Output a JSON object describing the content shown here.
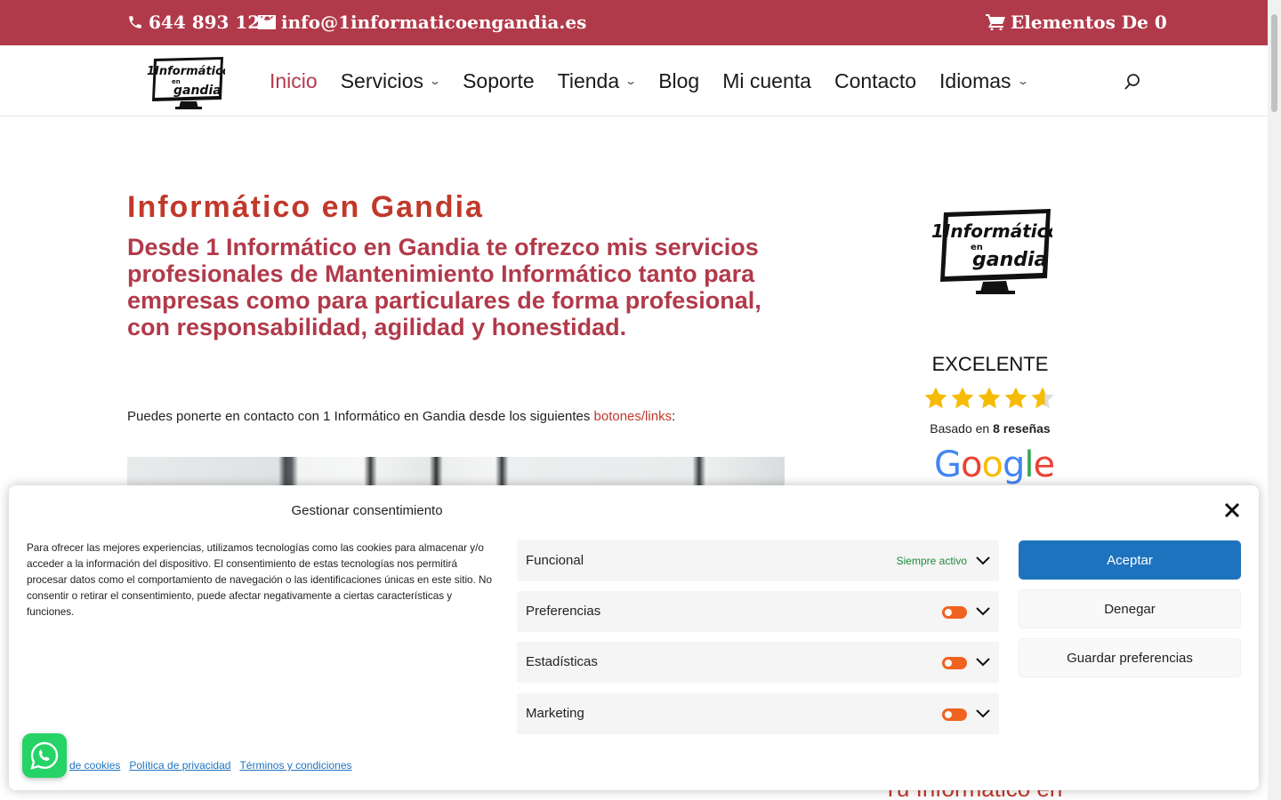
{
  "topbar": {
    "phone": "644 893 126",
    "email": "info@1informaticoengandia.es",
    "cart": "Elementos De 0"
  },
  "header": {
    "logo_line1": "1Informático",
    "logo_line2": "en",
    "logo_line3": "gandia",
    "nav": [
      {
        "label": "Inicio",
        "active": true,
        "has_dropdown": false
      },
      {
        "label": "Servicios",
        "active": false,
        "has_dropdown": true
      },
      {
        "label": "Soporte",
        "active": false,
        "has_dropdown": false
      },
      {
        "label": "Tienda",
        "active": false,
        "has_dropdown": true
      },
      {
        "label": "Blog",
        "active": false,
        "has_dropdown": false
      },
      {
        "label": "Mi cuenta",
        "active": false,
        "has_dropdown": false
      },
      {
        "label": "Contacto",
        "active": false,
        "has_dropdown": false
      },
      {
        "label": "Idiomas",
        "active": false,
        "has_dropdown": true
      }
    ]
  },
  "main": {
    "title": "Informático en Gandia",
    "intro": "Desde 1 Informático en Gandia te ofrezco mis servicios profesionales de Mantenimiento Informático tanto para empresas como para particulares de forma profesional, con responsabilidad, agilidad y honestidad.",
    "contact_prefix": "Puedes ponerte en contacto con 1 Informático en Gandia desde los siguientes ",
    "contact_link": "botones/links",
    "contact_suffix": ":"
  },
  "sidebar": {
    "rating_label": "EXCELENTE",
    "rating_value": 4.6,
    "rating_max": 5,
    "reviews_prefix": "Basado en ",
    "reviews_count": "8 reseñas",
    "google": [
      "G",
      "o",
      "o",
      "g",
      "l",
      "e"
    ],
    "heading": "Tu Informático en"
  },
  "consent": {
    "title": "Gestionar consentimiento",
    "text": "Para ofrecer las mejores experiencias, utilizamos tecnologías como las cookies para almacenar y/o acceder a la información del dispositivo. El consentimiento de estas tecnologías nos permitirá procesar datos como el comportamiento de navegación o las identificaciones únicas en este sitio. No consentir o retirar el consentimiento, puede afectar negativamente a ciertas características y funciones.",
    "categories": [
      {
        "label": "Funcional",
        "status": "Siempre activo"
      },
      {
        "label": "Preferencias"
      },
      {
        "label": "Estadísticas"
      },
      {
        "label": "Marketing"
      }
    ],
    "buttons": {
      "accept": "Aceptar",
      "deny": "Denegar",
      "save": "Guardar preferencias"
    },
    "links": [
      "de cookies",
      "Política de privacidad",
      "Términos y condiciones"
    ]
  },
  "colors": {
    "brand": "#b13a4a",
    "title_red": "#c0392b",
    "accept_blue": "#1e73be",
    "toggle_orange": "#f0621f",
    "whatsapp_green": "#25d366"
  }
}
